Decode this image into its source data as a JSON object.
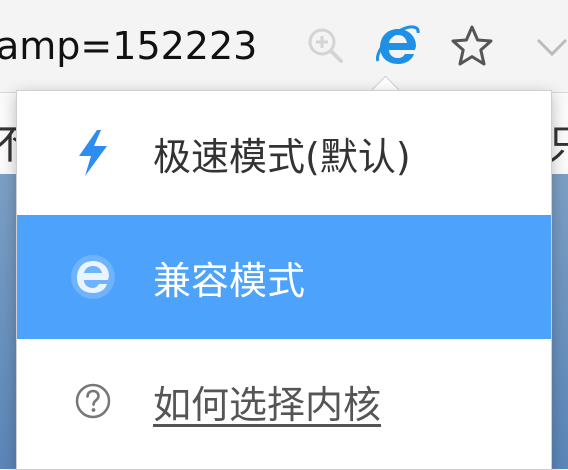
{
  "address_bar": {
    "url_fragment": "amp=152223"
  },
  "toolbar": {
    "zoom_icon": "zoom-in-icon",
    "engine_icon": "ie-icon",
    "favorite_icon": "star-icon",
    "more_icon": "chevron-down-icon"
  },
  "background": {
    "left_char": "不",
    "right_char": "只"
  },
  "menu": {
    "items": [
      {
        "label": "极速模式(默认)",
        "icon": "lightning-icon",
        "selected": false
      },
      {
        "label": "兼容模式",
        "icon": "ie-icon",
        "selected": true
      },
      {
        "label": "如何选择内核",
        "icon": "help-icon",
        "selected": false
      }
    ]
  },
  "colors": {
    "selected_bg": "#4da2fb",
    "ie_blue": "#1e90e6",
    "lightning_blue": "#2f8cf0"
  }
}
